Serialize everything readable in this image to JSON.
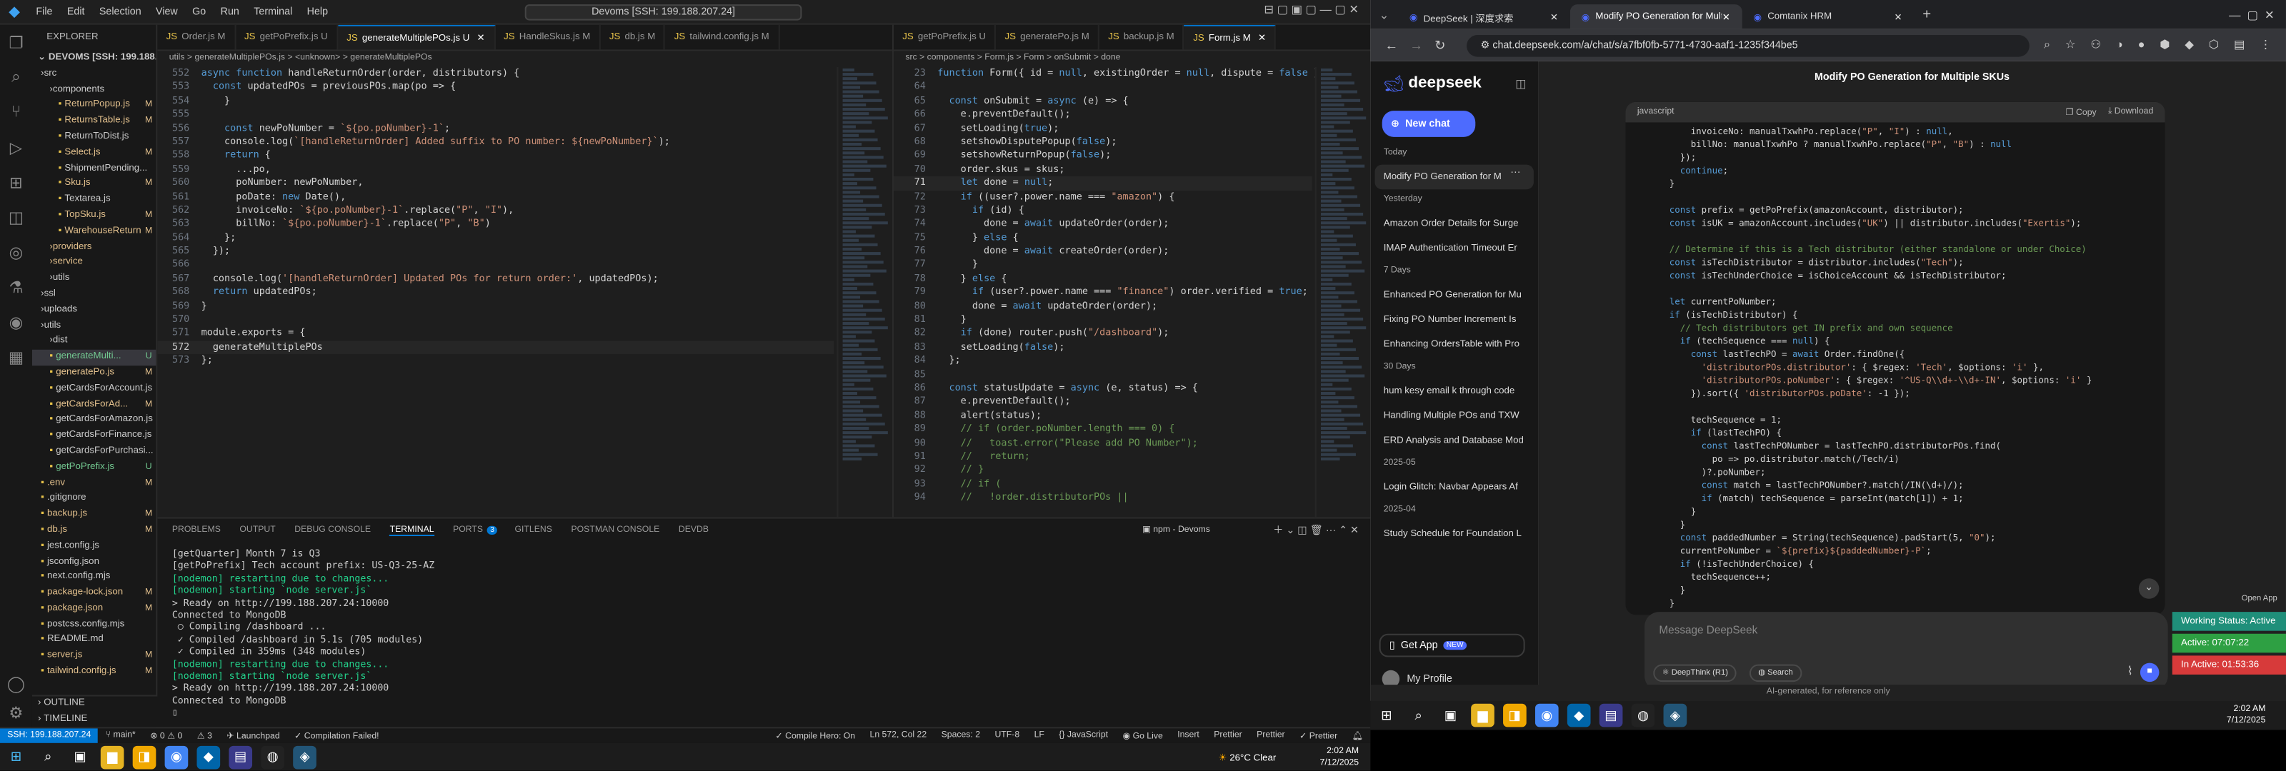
{
  "vscode": {
    "menu": [
      "File",
      "Edit",
      "Selection",
      "View",
      "Go",
      "Run",
      "Terminal",
      "Help"
    ],
    "search": "Devoms [SSH: 199.188.207.24]",
    "explorer_title": "EXPLORER",
    "root": "DEVOMS [SSH: 199.188.20...",
    "tree": [
      {
        "name": "src",
        "indent": 1,
        "type": "folder"
      },
      {
        "name": "components",
        "indent": 2,
        "type": "folder"
      },
      {
        "name": "ReturnPopup.js",
        "indent": 3,
        "badge": "M",
        "badge_cls": "M",
        "color": "#e2c08d"
      },
      {
        "name": "ReturnsTable.js",
        "indent": 3,
        "badge": "M",
        "badge_cls": "M",
        "color": "#e2c08d"
      },
      {
        "name": "ReturnToDist.js",
        "indent": 3,
        "badge": "",
        "badge_cls": "",
        "color": "#ccc"
      },
      {
        "name": "Select.js",
        "indent": 3,
        "badge": "M",
        "badge_cls": "M",
        "color": "#e2c08d"
      },
      {
        "name": "ShipmentPending...",
        "indent": 3,
        "badge": "",
        "badge_cls": "",
        "color": "#ccc"
      },
      {
        "name": "Sku.js",
        "indent": 3,
        "badge": "M",
        "badge_cls": "M",
        "color": "#e2c08d"
      },
      {
        "name": "Textarea.js",
        "indent": 3,
        "badge": "",
        "badge_cls": "",
        "color": "#ccc"
      },
      {
        "name": "TopSku.js",
        "indent": 3,
        "badge": "M",
        "badge_cls": "M",
        "color": "#e2c08d"
      },
      {
        "name": "WarehouseReturn.js",
        "indent": 3,
        "badge": "M",
        "badge_cls": "M",
        "color": "#e2c08d"
      },
      {
        "name": "providers",
        "indent": 2,
        "type": "folder",
        "color": "#e2c08d"
      },
      {
        "name": "service",
        "indent": 2,
        "type": "folder",
        "color": "#e2c08d"
      },
      {
        "name": "utils",
        "indent": 2,
        "type": "folder"
      },
      {
        "name": "ssl",
        "indent": 1,
        "type": "folder"
      },
      {
        "name": "uploads",
        "indent": 1,
        "type": "folder"
      },
      {
        "name": "utils",
        "indent": 1,
        "type": "folder"
      },
      {
        "name": "dist",
        "indent": 2,
        "type": "folder"
      },
      {
        "name": "generateMulti...",
        "indent": 2,
        "badge": "U",
        "badge_cls": "U",
        "color": "#73c991",
        "sel": true
      },
      {
        "name": "generatePo.js",
        "indent": 2,
        "badge": "M",
        "badge_cls": "M",
        "color": "#e2c08d"
      },
      {
        "name": "getCardsForAccount.js",
        "indent": 2,
        "badge": "",
        "badge_cls": "",
        "color": "#ccc"
      },
      {
        "name": "getCardsForAd...",
        "indent": 2,
        "badge": "M",
        "badge_cls": "M",
        "color": "#e2c08d"
      },
      {
        "name": "getCardsForAmazon.js",
        "indent": 2,
        "badge": "",
        "badge_cls": "",
        "color": "#ccc"
      },
      {
        "name": "getCardsForFinance.js",
        "indent": 2,
        "badge": "",
        "badge_cls": "",
        "color": "#ccc"
      },
      {
        "name": "getCardsForPurchasi...",
        "indent": 2,
        "badge": "",
        "badge_cls": "",
        "color": "#ccc"
      },
      {
        "name": "getPoPrefix.js",
        "indent": 2,
        "badge": "U",
        "badge_cls": "U",
        "color": "#73c991"
      },
      {
        "name": ".env",
        "indent": 1,
        "badge": "M",
        "badge_cls": "M",
        "color": "#e2c08d"
      },
      {
        "name": ".gitignore",
        "indent": 1,
        "badge": "",
        "badge_cls": "",
        "color": "#ccc"
      },
      {
        "name": "backup.js",
        "indent": 1,
        "badge": "M",
        "badge_cls": "M",
        "color": "#e2c08d"
      },
      {
        "name": "db.js",
        "indent": 1,
        "badge": "M",
        "badge_cls": "M",
        "color": "#e2c08d"
      },
      {
        "name": "jest.config.js",
        "indent": 1,
        "badge": "",
        "badge_cls": "",
        "color": "#ccc"
      },
      {
        "name": "jsconfig.json",
        "indent": 1,
        "badge": "",
        "badge_cls": "",
        "color": "#ccc"
      },
      {
        "name": "next.config.mjs",
        "indent": 1,
        "badge": "",
        "badge_cls": "",
        "color": "#ccc"
      },
      {
        "name": "package-lock.json",
        "indent": 1,
        "badge": "M",
        "badge_cls": "M",
        "color": "#e2c08d"
      },
      {
        "name": "package.json",
        "indent": 1,
        "badge": "M",
        "badge_cls": "M",
        "color": "#e2c08d"
      },
      {
        "name": "postcss.config.mjs",
        "indent": 1,
        "badge": "",
        "badge_cls": "",
        "color": "#ccc"
      },
      {
        "name": "README.md",
        "indent": 1,
        "badge": "",
        "badge_cls": "",
        "color": "#ccc"
      },
      {
        "name": "server.js",
        "indent": 1,
        "badge": "M",
        "badge_cls": "M",
        "color": "#e2c08d"
      },
      {
        "name": "tailwind.config.js",
        "indent": 1,
        "badge": "M",
        "badge_cls": "M",
        "color": "#e2c08d"
      }
    ],
    "outline": "OUTLINE",
    "timeline": "TIMELINE",
    "tabs1": [
      {
        "label": "Order.js M",
        "active": false
      },
      {
        "label": "getPoPrefix.js U",
        "active": false
      },
      {
        "label": "generateMultiplePOs.js U",
        "active": true
      },
      {
        "label": "HandleSkus.js M",
        "active": false
      },
      {
        "label": "db.js M",
        "active": false
      },
      {
        "label": "tailwind.config.js M",
        "active": false
      }
    ],
    "tabs2": [
      {
        "label": "getPoPrefix.js U",
        "active": false
      },
      {
        "label": "generatePo.js M",
        "active": false
      },
      {
        "label": "backup.js M",
        "active": false
      },
      {
        "label": "Form.js M",
        "active": true
      }
    ],
    "crumb1": "utils > generateMultiplePOs.js > <unknown> > generateMultiplePOs",
    "crumb2": "src > components > Form.js > Form > onSubmit > done",
    "code1": [
      {
        "n": "552",
        "t": "async function handleReturnOrder(order, distributors) {"
      },
      {
        "n": "553",
        "t": "  const updatedPOs = previousPOs.map(po => {"
      },
      {
        "n": "554",
        "t": "    }"
      },
      {
        "n": "555",
        "t": ""
      },
      {
        "n": "556",
        "t": "    const newPoNumber = `${po.poNumber}-1`;"
      },
      {
        "n": "557",
        "t": "    console.log(`[handleReturnOrder] Added suffix to PO number: ${newPoNumber}`);"
      },
      {
        "n": "558",
        "t": "    return {"
      },
      {
        "n": "559",
        "t": "      ...po,"
      },
      {
        "n": "560",
        "t": "      poNumber: newPoNumber,"
      },
      {
        "n": "561",
        "t": "      poDate: new Date(),"
      },
      {
        "n": "562",
        "t": "      invoiceNo: `${po.poNumber}-1`.replace(\"P\", \"I\"),"
      },
      {
        "n": "563",
        "t": "      billNo: `${po.poNumber}-1`.replace(\"P\", \"B\")"
      },
      {
        "n": "564",
        "t": "    };"
      },
      {
        "n": "565",
        "t": "  });"
      },
      {
        "n": "566",
        "t": ""
      },
      {
        "n": "567",
        "t": "  console.log('[handleReturnOrder] Updated POs for return order:', updatedPOs);"
      },
      {
        "n": "568",
        "t": "  return updatedPOs;"
      },
      {
        "n": "569",
        "t": "}"
      },
      {
        "n": "570",
        "t": ""
      },
      {
        "n": "571",
        "t": "module.exports = {"
      },
      {
        "n": "572",
        "t": "  generateMultiplePOs"
      },
      {
        "n": "573",
        "t": "};"
      }
    ],
    "code2": [
      {
        "n": "23",
        "t": "function Form({ id = null, existingOrder = null, dispute = false }"
      },
      {
        "n": "64",
        "t": ""
      },
      {
        "n": "65",
        "t": "  const onSubmit = async (e) => {"
      },
      {
        "n": "66",
        "t": "    e.preventDefault();"
      },
      {
        "n": "67",
        "t": "    setLoading(true);"
      },
      {
        "n": "68",
        "t": "    setshowDisputePopup(false);"
      },
      {
        "n": "69",
        "t": "    setshowReturnPopup(false);"
      },
      {
        "n": "70",
        "t": "    order.skus = skus;"
      },
      {
        "n": "71",
        "t": "    let done = null;"
      },
      {
        "n": "72",
        "t": "    if ((user?.power.name === \"amazon\") {"
      },
      {
        "n": "73",
        "t": "      if (id) {"
      },
      {
        "n": "74",
        "t": "        done = await updateOrder(order);"
      },
      {
        "n": "75",
        "t": "      } else {"
      },
      {
        "n": "76",
        "t": "        done = await createOrder(order);"
      },
      {
        "n": "77",
        "t": "      }"
      },
      {
        "n": "78",
        "t": "    } else {"
      },
      {
        "n": "79",
        "t": "      if (user?.power.name === \"finance\") order.verified = true;"
      },
      {
        "n": "80",
        "t": "      done = await updateOrder(order);"
      },
      {
        "n": "81",
        "t": "    }"
      },
      {
        "n": "82",
        "t": "    if (done) router.push(\"/dashboard\");"
      },
      {
        "n": "83",
        "t": "    setLoading(false);"
      },
      {
        "n": "84",
        "t": "  };"
      },
      {
        "n": "85",
        "t": ""
      },
      {
        "n": "86",
        "t": "  const statusUpdate = async (e, status) => {"
      },
      {
        "n": "87",
        "t": "    e.preventDefault();"
      },
      {
        "n": "88",
        "t": "    alert(status);"
      },
      {
        "n": "89",
        "t": "    // if (order.poNumber.length === 0) {"
      },
      {
        "n": "90",
        "t": "    //   toast.error(\"Please add PO Number\");"
      },
      {
        "n": "91",
        "t": "    //   return;"
      },
      {
        "n": "92",
        "t": "    // }"
      },
      {
        "n": "93",
        "t": "    // if ("
      },
      {
        "n": "94",
        "t": "    //   !order.distributorPOs ||"
      }
    ],
    "panel_tabs": [
      "PROBLEMS",
      "OUTPUT",
      "DEBUG CONSOLE",
      "TERMINAL",
      "PORTS",
      "GITLENS",
      "POSTMAN CONSOLE",
      "DEVDB"
    ],
    "ports_badge": "3",
    "terminal_name": "npm - Devoms",
    "terminal": [
      {
        "t": "[getQuarter] Month 7 is Q3",
        "c": "#ccc"
      },
      {
        "t": "[getPoPrefix] Tech account prefix: US-Q3-25-AZ",
        "c": "#ccc"
      },
      {
        "t": "[nodemon] restarting due to changes...",
        "c": "#23d18b"
      },
      {
        "t": "[nodemon] starting `node server.js`",
        "c": "#23d18b"
      },
      {
        "t": "> Ready on http://199.188.207.24:10000",
        "c": "#ccc"
      },
      {
        "t": "Connected to MongoDB",
        "c": "#ccc"
      },
      {
        "t": " ○ Compiling /dashboard ...",
        "c": "#ccc"
      },
      {
        "t": " ✓ Compiled /dashboard in 5.1s (705 modules)",
        "c": "#ccc"
      },
      {
        "t": " ✓ Compiled in 359ms (348 modules)",
        "c": "#ccc"
      },
      {
        "t": "[nodemon] restarting due to changes...",
        "c": "#23d18b"
      },
      {
        "t": "[nodemon] starting `node server.js`",
        "c": "#23d18b"
      },
      {
        "t": "> Ready on http://199.188.207.24:10000",
        "c": "#ccc"
      },
      {
        "t": "Connected to MongoDB",
        "c": "#ccc"
      }
    ],
    "status": {
      "ssh": "SSH: 199.188.207.24",
      "branch": "main*",
      "sync": "⊗ 0 ⚠ 0",
      "errs": "3",
      "launchpad": "Launchpad",
      "compile": "Compilation Failed!",
      "compile_hero": "Compile Hero: On",
      "pos": "Ln 572, Col 22",
      "spaces": "Spaces: 2",
      "enc": "UTF-8",
      "eol": "LF",
      "lang": "JavaScript",
      "golive": "Go Live",
      "insert": "Insert",
      "prettier1": "Prettier",
      "prettier2": "Prettier",
      "prettier3": "Prettier"
    }
  },
  "browser": {
    "tabs": [
      {
        "label": "DeepSeek | 深度求索",
        "active": false
      },
      {
        "label": "Modify PO Generation for Multi",
        "active": true
      },
      {
        "label": "Comtanix HRM",
        "active": false
      }
    ],
    "url": "chat.deepseek.com/a/chat/s/a7fbf0fb-5771-4730-aaf1-1235f344be5",
    "ds": {
      "logo": "deepseek",
      "new_chat": "New chat",
      "groups": [
        {
          "h": "Today",
          "items": [
            "Modify PO Generation for M"
          ]
        },
        {
          "h": "Yesterday",
          "items": [
            "Amazon Order Details for Surge",
            "IMAP Authentication Timeout Er"
          ]
        },
        {
          "h": "7 Days",
          "items": [
            "Enhanced PO Generation for Mu",
            "Fixing PO Number Increment Is",
            "Enhancing OrdersTable with Pro"
          ]
        },
        {
          "h": "30 Days",
          "items": [
            "hum kesy email k through code",
            "Handling Multiple POs and TXW",
            "ERD Analysis and Database Mod"
          ]
        },
        {
          "h": "2025-05",
          "items": [
            "Login Glitch: Navbar Appears Af"
          ]
        },
        {
          "h": "2025-04",
          "items": [
            "Study Schedule for Foundation L"
          ]
        }
      ],
      "get_app": "Get App",
      "new_badge": "NEW",
      "profile": "My Profile",
      "chat_title": "Modify PO Generation for Multiple SKUs",
      "code_lang": "javascript",
      "copy": "Copy",
      "download": "Download",
      "code": [
        "          invoiceNo: manualTxwhPo.replace(\"P\", \"I\") : null,",
        "          billNo: manualTxwhPo ? manualTxwhPo.replace(\"P\", \"B\") : null",
        "        });",
        "        continue;",
        "      }",
        "",
        "      const prefix = getPoPrefix(amazonAccount, distributor);",
        "      const isUK = amazonAccount.includes(\"UK\") || distributor.includes(\"Exertis\");",
        "",
        "      // Determine if this is a Tech distributor (either standalone or under Choice)",
        "      const isTechDistributor = distributor.includes(\"Tech\");",
        "      const isTechUnderChoice = isChoiceAccount && isTechDistributor;",
        "",
        "      let currentPoNumber;",
        "      if (isTechDistributor) {",
        "        // Tech distributors get IN prefix and own sequence",
        "        if (techSequence === null) {",
        "          const lastTechPO = await Order.findOne({",
        "            'distributorPOs.distributor': { $regex: 'Tech', $options: 'i' },",
        "            'distributorPOs.poNumber': { $regex: '^US-Q\\\\d+-\\\\d+-IN', $options: 'i' }",
        "          }).sort({ 'distributorPOs.poDate': -1 });",
        "",
        "          techSequence = 1;",
        "          if (lastTechPO) {",
        "            const lastTechPONumber = lastTechPO.distributorPOs.find(",
        "              po => po.distributor.match(/Tech/i)",
        "            )?.poNumber;",
        "            const match = lastTechPONumber?.match(/IN(\\d+)/);",
        "            if (match) techSequence = parseInt(match[1]) + 1;",
        "          }",
        "        }",
        "        const paddedNumber = String(techSequence).padStart(5, \"0\");",
        "        currentPoNumber = `${prefix}${paddedNumber}-P`;",
        "        if (!isTechUnderChoice) {",
        "          techSequence++;",
        "        }",
        "      }",
        "      else if (isChoiceAccount) {"
      ],
      "placeholder": "Message DeepSeek",
      "deepthink": "DeepThink (R1)",
      "search": "Search",
      "ai_note": "AI-generated, for reference only",
      "open_app": "Open App"
    },
    "hrm": [
      {
        "label": "Working Status: Active",
        "color": "#1f8f7a"
      },
      {
        "label": "Active: 07:07:22",
        "color": "#2ea043"
      },
      {
        "label": "In Active: 01:53:36",
        "color": "#d73a3a"
      }
    ],
    "time": "2:02 AM",
    "date": "7/12/2025"
  },
  "taskbar": {
    "weather": "26°C  Clear",
    "time": "2:02 AM",
    "date": "7/12/2025"
  }
}
